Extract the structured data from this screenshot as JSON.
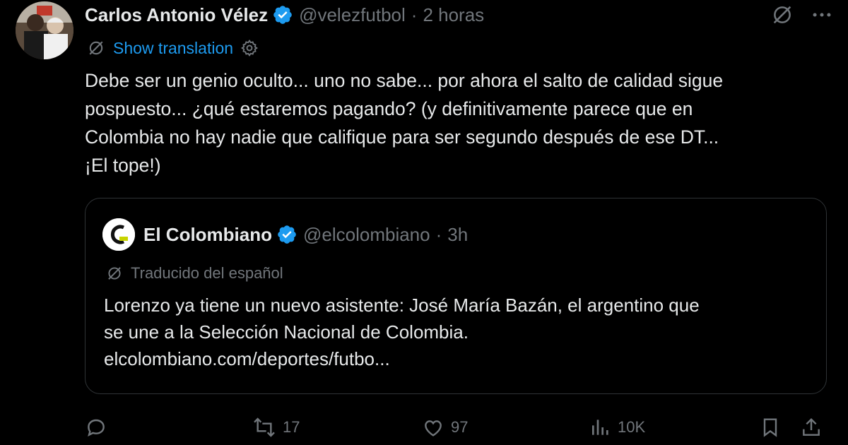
{
  "post": {
    "author_name": "Carlos Antonio Vélez",
    "handle": "@velezfutbol",
    "separator": "·",
    "time": "2 horas",
    "show_translation": "Show translation",
    "text_lines": [
      "Debe ser un genio oculto... uno no sabe... por ahora el salto de calidad sigue",
      "pospuesto... ¿qué estaremos pagando? (y definitivamente parece que en",
      "Colombia no hay nadie que califique para ser segundo después de ese DT...",
      "¡El tope!)"
    ]
  },
  "quote": {
    "author_name": "El Colombiano",
    "handle": "@elcolombiano",
    "separator": "·",
    "time": "3h",
    "translated_note": "Traducido del español",
    "text_lines": [
      "Lorenzo ya tiene un nuevo asistente: José María Bazán, el argentino que",
      "se une a la Selección Nacional de Colombia.",
      "elcolombiano.com/deportes/futbo..."
    ]
  },
  "actions": {
    "reposts": "17",
    "likes": "97",
    "views": "10K"
  },
  "colors": {
    "background": "#000000",
    "text_primary": "#e7e9ea",
    "text_secondary": "#71767b",
    "link_blue": "#1d9bf0",
    "verified_blue": "#1d9bf0",
    "border": "#2f3336"
  },
  "icons": {
    "verified": "verified-badge-icon",
    "grok": "grok-icon",
    "more": "more-dots-icon",
    "translate": "translate-icon",
    "settings": "gear-icon",
    "reply": "reply-icon",
    "repost": "repost-icon",
    "like": "heart-icon",
    "views": "views-chart-icon",
    "bookmark": "bookmark-icon",
    "share": "share-icon"
  }
}
